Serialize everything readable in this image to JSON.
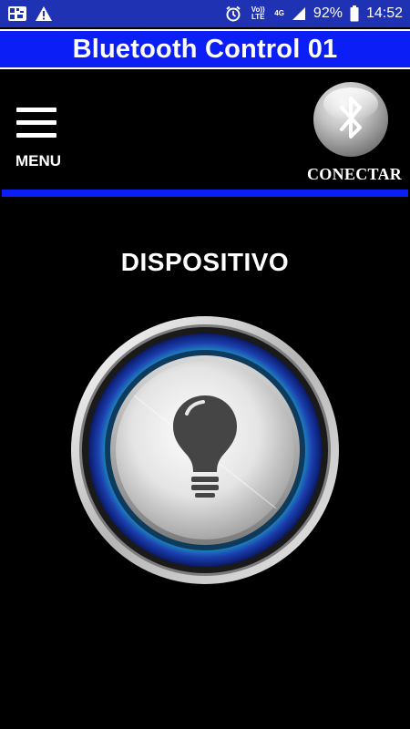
{
  "status_bar": {
    "battery": "92%",
    "time": "14:52",
    "volte": "Vo)) LTE",
    "network": "4G",
    "icons": [
      "qr-icon",
      "warning-icon",
      "alarm-icon",
      "volte-icon",
      "network-4g-icon",
      "signal-icon",
      "battery-icon"
    ]
  },
  "app": {
    "title": "Bluetooth Control 01"
  },
  "toolbar": {
    "menu_label": "MENU",
    "connect_label": "CONECTAR",
    "connect_icon": "bluetooth-icon"
  },
  "main": {
    "device_label": "DISPOSITIVO",
    "device_icon": "lightbulb-icon"
  },
  "colors": {
    "accent": "#0a1ef5",
    "status_bar": "#1f32b4",
    "background": "#000000",
    "ring_glow": "#1ea8c8"
  }
}
